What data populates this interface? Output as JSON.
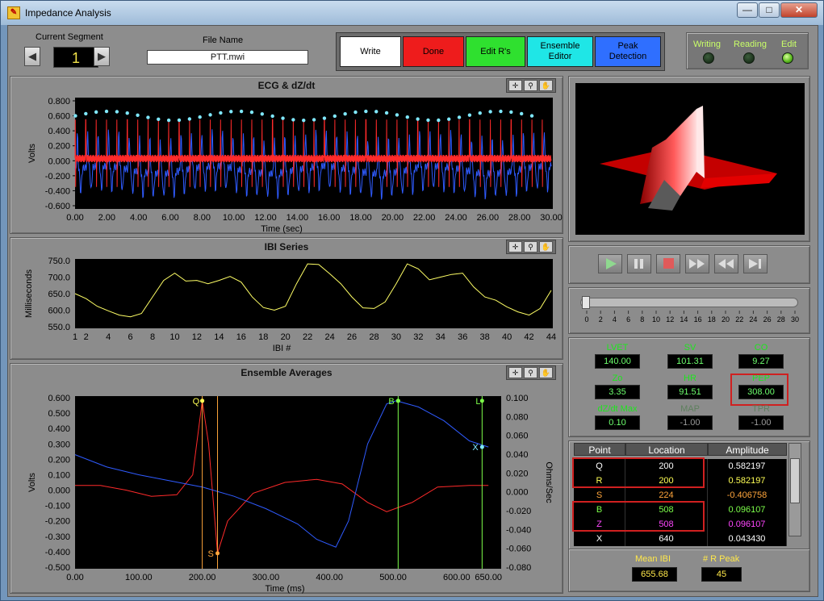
{
  "window": {
    "title": "Impedance Analysis",
    "min": "—",
    "max": "□",
    "close": "✕"
  },
  "segment": {
    "label": "Current Segment",
    "value": "1",
    "prev": "◀",
    "next": "▶"
  },
  "file": {
    "label": "File Name",
    "value": "PTT.mwi"
  },
  "buttons": [
    {
      "label": "Write",
      "color": "#ffffff",
      "text_color": "#000000"
    },
    {
      "label": "Done",
      "color": "#ee1c1c",
      "text_color": "#000000"
    },
    {
      "label": "Edit R's",
      "color": "#2fe02f",
      "text_color": "#000000"
    },
    {
      "label": "Ensemble Editor",
      "color": "#1fe6e6",
      "text_color": "#000000"
    },
    {
      "label": "Peak Detection",
      "color": "#2f6fff",
      "text_color": "#000000"
    }
  ],
  "status": [
    {
      "label": "Writing",
      "on": false
    },
    {
      "label": "Reading",
      "on": false
    },
    {
      "label": "Edit",
      "on": true
    }
  ],
  "ecg": {
    "title": "ECG & dZ/dt",
    "ylabel": "Volts",
    "xlabel": "Time (sec)",
    "yticks": [
      "0.800",
      "0.600",
      "0.400",
      "0.200",
      "0.000",
      "-0.200",
      "-0.400",
      "-0.600"
    ],
    "xticks": [
      "0.00",
      "2.00",
      "4.00",
      "6.00",
      "8.00",
      "10.00",
      "12.00",
      "14.00",
      "16.00",
      "18.00",
      "20.00",
      "22.00",
      "24.00",
      "26.00",
      "28.00",
      "30.00"
    ]
  },
  "ibi": {
    "title": "IBI Series",
    "ylabel": "Milliseconds",
    "xlabel": "IBI #",
    "yticks": [
      "750.0",
      "700.0",
      "650.0",
      "600.0",
      "550.0"
    ],
    "xticks": [
      "1",
      "2",
      "4",
      "6",
      "8",
      "10",
      "12",
      "14",
      "16",
      "18",
      "20",
      "22",
      "24",
      "26",
      "28",
      "30",
      "32",
      "34",
      "36",
      "38",
      "40",
      "42",
      "44"
    ]
  },
  "ensemble": {
    "title": "Ensemble Averages",
    "ylabel": "Volts",
    "y2label": "Ohms/Sec",
    "xlabel": "Time (ms)",
    "yticks": [
      "0.600",
      "0.500",
      "0.400",
      "0.300",
      "0.200",
      "0.100",
      "0.000",
      "-0.100",
      "-0.200",
      "-0.300",
      "-0.400",
      "-0.500"
    ],
    "y2ticks": [
      "0.100",
      "0.080",
      "0.060",
      "0.040",
      "0.020",
      "0.000",
      "-0.020",
      "-0.040",
      "-0.060",
      "-0.080"
    ],
    "xticks": [
      "0.00",
      "100.00",
      "200.00",
      "300.00",
      "400.00",
      "500.00",
      "600.00",
      "650.00"
    ],
    "markers": [
      "Q",
      "R",
      "S",
      "B",
      "Z",
      "L",
      "X"
    ]
  },
  "playback": {
    "play": "▶",
    "pause": "❚❚",
    "stop": "■",
    "ff": "▶▶",
    "rew": "◀◀",
    "end": "▶|",
    "slider_ticks": [
      "0",
      "2",
      "4",
      "6",
      "8",
      "10",
      "12",
      "14",
      "16",
      "18",
      "20",
      "22",
      "24",
      "26",
      "28",
      "30"
    ]
  },
  "indicators": [
    {
      "name": "LVET",
      "value": "140.00",
      "dim": false
    },
    {
      "name": "SV",
      "value": "101.31",
      "dim": false
    },
    {
      "name": "CO",
      "value": "9.27",
      "dim": false
    },
    {
      "name": "Zo",
      "value": "3.35",
      "dim": false
    },
    {
      "name": "HR",
      "value": "91.51",
      "dim": false
    },
    {
      "name": "PEP",
      "value": "308.00",
      "dim": false
    },
    {
      "name": "dZ/dt Max",
      "value": "0.10",
      "dim": false
    },
    {
      "name": "MAP",
      "value": "-1.00",
      "dim": true
    },
    {
      "name": "TPR",
      "value": "-1.00",
      "dim": true
    }
  ],
  "table": {
    "headers": [
      "Point",
      "Location",
      "Amplitude"
    ],
    "rows": [
      {
        "point": "Q",
        "location": "200",
        "amplitude": "0.582197",
        "color": "#ffffff"
      },
      {
        "point": "R",
        "location": "200",
        "amplitude": "0.582197",
        "color": "#ffff55"
      },
      {
        "point": "S",
        "location": "224",
        "amplitude": "-0.406758",
        "color": "#ffa53b"
      },
      {
        "point": "B",
        "location": "508",
        "amplitude": "0.096107",
        "color": "#7dff4a"
      },
      {
        "point": "Z",
        "location": "508",
        "amplitude": "0.096107",
        "color": "#ff46ff"
      },
      {
        "point": "X",
        "location": "640",
        "amplitude": "0.043430",
        "color": "#ffffff"
      }
    ]
  },
  "summary": {
    "mean_ibi_label": "Mean IBI",
    "mean_ibi": "655.68",
    "r_peak_label": "# R Peak",
    "r_peak": "45"
  },
  "colors": {
    "ecg": "#ff2a2a",
    "dzdt": "#2f5bff",
    "rpeak": "#7fe8ff",
    "ibi": "#ffff66",
    "green": "#7dff4a",
    "orange": "#ffa53b"
  }
}
